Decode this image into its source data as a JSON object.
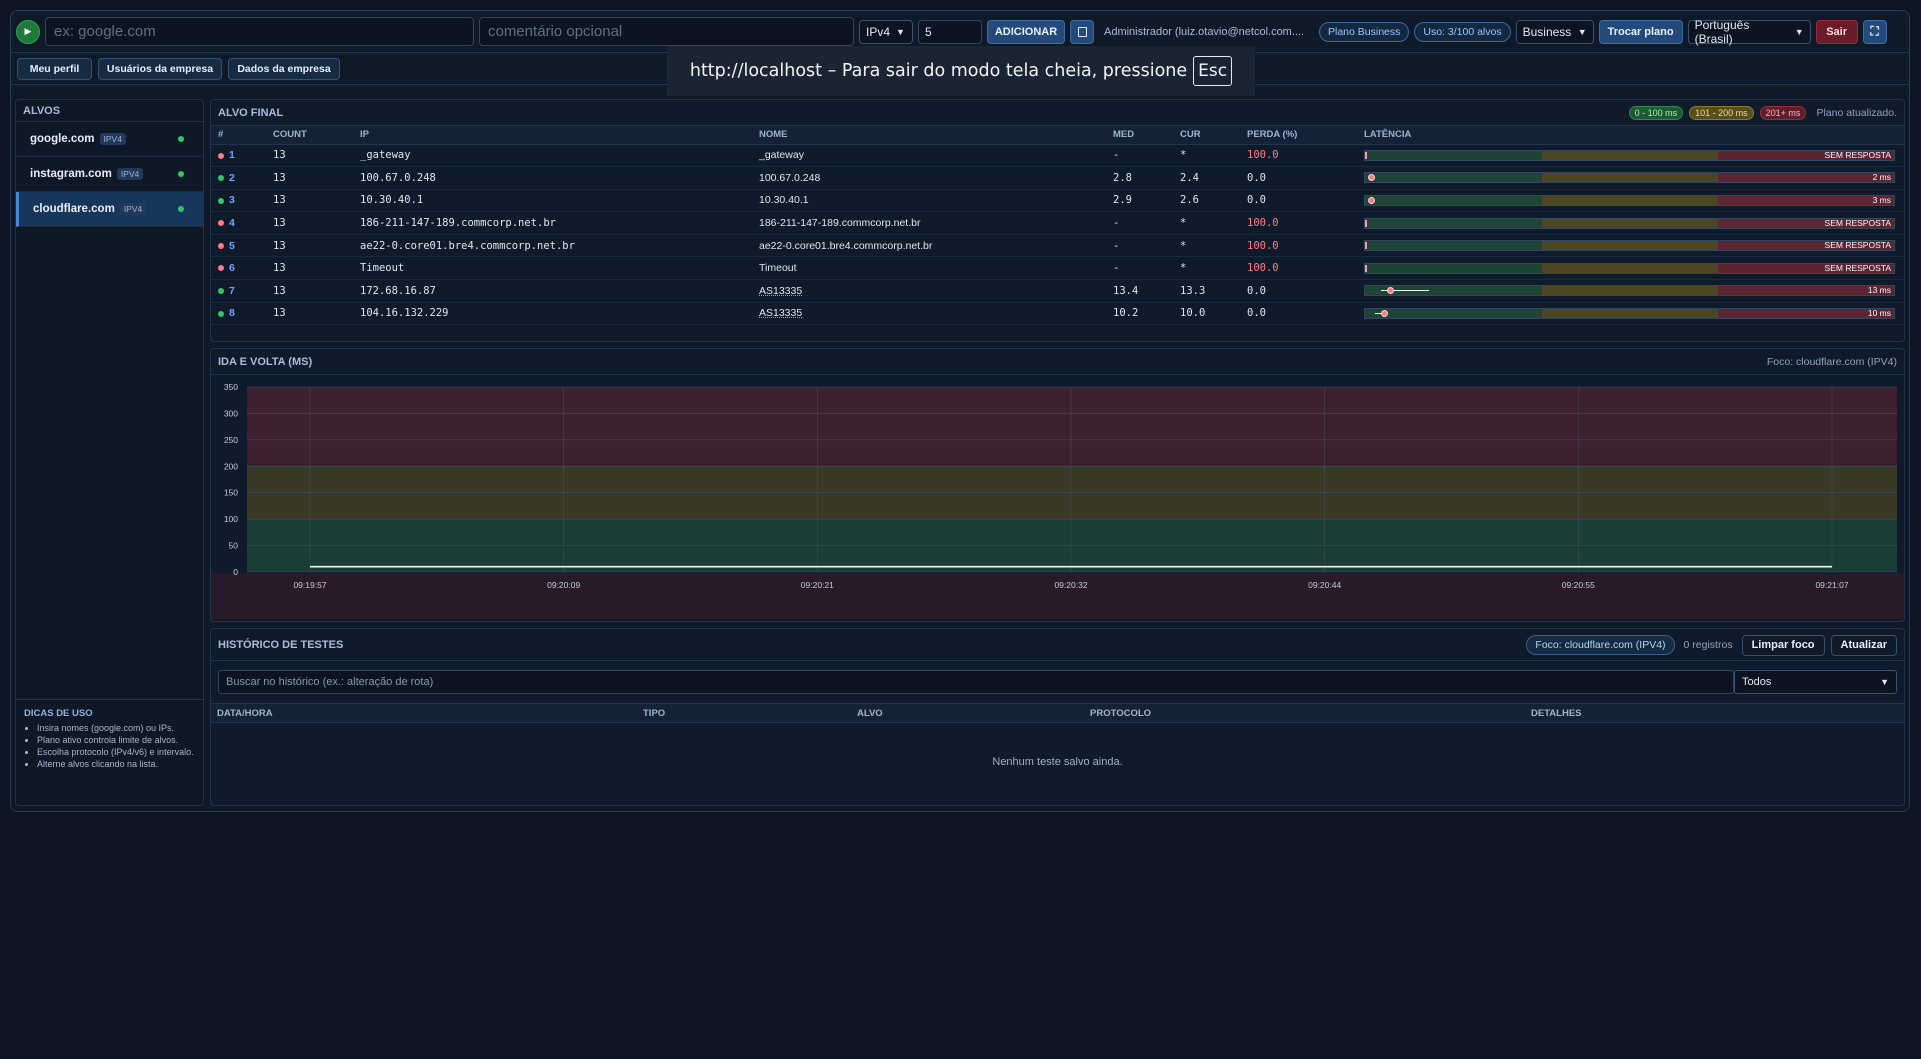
{
  "toolbar": {
    "host_placeholder": "ex: google.com",
    "comment_placeholder": "comentário opcional",
    "protocol": "IPv4",
    "interval": "5",
    "add_label": "ADICIONAR",
    "user": "Administrador (luiz.otavio@netcol.com....",
    "plan_pill": "Plano Business",
    "usage_pill": "Uso: 3/100 alvos",
    "plan_select": "Business",
    "change_plan": "Trocar plano",
    "language": "Português (Brasil)",
    "logout": "Sair"
  },
  "nav": {
    "profile": "Meu perfil",
    "users": "Usuários da empresa",
    "company": "Dados da empresa"
  },
  "fullscreen_note": {
    "text": "http://localhost – Para sair do modo tela cheia, pressione",
    "key": "Esc"
  },
  "sidebar": {
    "title": "ALVOS",
    "targets": [
      {
        "name": "google.com",
        "proto": "IPV4"
      },
      {
        "name": "instagram.com",
        "proto": "IPV4"
      },
      {
        "name": "cloudflare.com",
        "proto": "IPV4"
      }
    ],
    "tips_title": "DICAS DE USO",
    "tips": [
      "Insira nomes (google.com) ou IPs.",
      "Plano ativo controla limite de alvos.",
      "Escolha protocolo (IPv4/v6) e intervalo.",
      "Alterne alvos clicando na lista."
    ]
  },
  "final_target": {
    "title": "ALVO FINAL",
    "legend": [
      "0 - 100 ms",
      "101 - 200 ms",
      "201+ ms"
    ],
    "status": "Plano atualizado.",
    "columns": [
      "#",
      "COUNT",
      "IP",
      "NOME",
      "MED",
      "CUR",
      "PERDA (%)",
      "LATÊNCIA"
    ],
    "rows": [
      {
        "n": "1",
        "count": "13",
        "ip": "_gateway",
        "nome": "_gateway",
        "med": "-",
        "cur": "*",
        "loss": "100.0",
        "ok": false,
        "lat_label": "SEM RESPOSTA"
      },
      {
        "n": "2",
        "count": "13",
        "ip": "100.67.0.248",
        "nome": "100.67.0.248",
        "med": "2.8",
        "cur": "2.4",
        "loss": "0.0",
        "ok": true,
        "lat_label": "2 ms"
      },
      {
        "n": "3",
        "count": "13",
        "ip": "10.30.40.1",
        "nome": "10.30.40.1",
        "med": "2.9",
        "cur": "2.6",
        "loss": "0.0",
        "ok": true,
        "lat_label": "3 ms"
      },
      {
        "n": "4",
        "count": "13",
        "ip": "186-211-147-189.commcorp.net.br",
        "nome": "186-211-147-189.commcorp.net.br",
        "med": "-",
        "cur": "*",
        "loss": "100.0",
        "ok": false,
        "lat_label": "SEM RESPOSTA"
      },
      {
        "n": "5",
        "count": "13",
        "ip": "ae22-0.core01.bre4.commcorp.net.br",
        "nome": "ae22-0.core01.bre4.commcorp.net.br",
        "med": "-",
        "cur": "*",
        "loss": "100.0",
        "ok": false,
        "lat_label": "SEM RESPOSTA"
      },
      {
        "n": "6",
        "count": "13",
        "ip": "Timeout",
        "nome": "Timeout",
        "med": "-",
        "cur": "*",
        "loss": "100.0",
        "ok": false,
        "lat_label": "SEM RESPOSTA"
      },
      {
        "n": "7",
        "count": "13",
        "ip": "172.68.16.87",
        "nome": "AS13335",
        "med": "13.4",
        "cur": "13.3",
        "loss": "0.0",
        "ok": true,
        "lat_label": "13 ms"
      },
      {
        "n": "8",
        "count": "13",
        "ip": "104.16.132.229",
        "nome": "AS13335",
        "med": "10.2",
        "cur": "10.0",
        "loss": "0.0",
        "ok": true,
        "lat_label": "10 ms"
      }
    ]
  },
  "rtt": {
    "title": "IDA E VOLTA (MS)",
    "focus": "Foco: cloudflare.com (IPV4)"
  },
  "chart_data": {
    "type": "line",
    "title": "IDA E VOLTA (MS)",
    "x": [
      "09:19:57",
      "09:20:09",
      "09:20:21",
      "09:20:32",
      "09:20:44",
      "09:20:55",
      "09:21:07"
    ],
    "ylim": [
      0,
      350
    ],
    "yticks": [
      0,
      50,
      100,
      150,
      200,
      250,
      300,
      350
    ],
    "bands": [
      {
        "from": 0,
        "to": 100,
        "color": "#1f4a3a"
      },
      {
        "from": 100,
        "to": 200,
        "color": "#4a4426"
      },
      {
        "from": 200,
        "to": 350,
        "color": "#4f2433"
      }
    ],
    "series": [
      {
        "values": [
          10,
          10,
          10,
          10,
          10,
          10,
          10
        ],
        "color": "#f2f4f7"
      }
    ],
    "grid": true
  },
  "history": {
    "title": "HISTÓRICO DE TESTES",
    "focus": "Foco: cloudflare.com (IPV4)",
    "count": "0 registros",
    "clear_focus": "Limpar foco",
    "refresh": "Atualizar",
    "search_placeholder": "Buscar no histórico (ex.: alteração de rota)",
    "filter": "Todos",
    "columns": [
      "DATA/HORA",
      "TIPO",
      "ALVO",
      "PROTOCOLO",
      "DETALHES"
    ],
    "empty": "Nenhum teste salvo ainda."
  },
  "colors": {
    "ok": "#36c46a",
    "bad": "#ff7b8a",
    "accent": "#244a7c"
  }
}
